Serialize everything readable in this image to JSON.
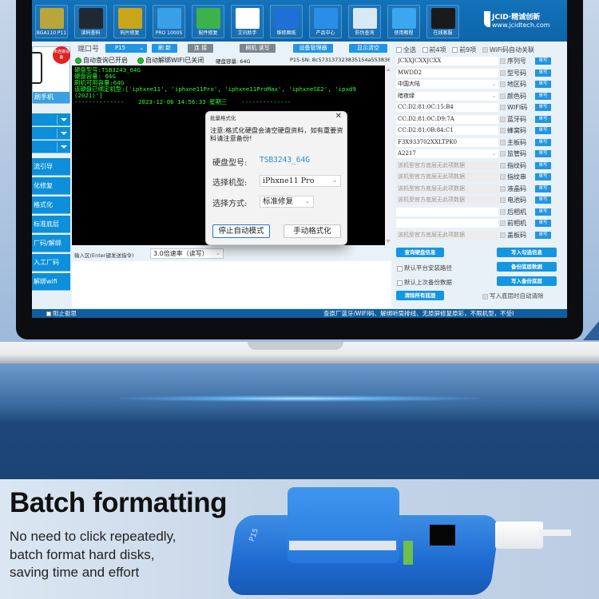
{
  "toolbar": {
    "buttons": [
      {
        "label": "BGA110 P11",
        "icon": "chip-grid-icon",
        "color": "#b8a63a"
      },
      {
        "label": "读码查码",
        "icon": "phone-icon",
        "color": "#222831"
      },
      {
        "label": "码片修复",
        "icon": "chip-dots-icon",
        "color": "#caa51a"
      },
      {
        "label": "PRO 1000S",
        "icon": "device-box-icon",
        "color": "#3b9ee8"
      },
      {
        "label": "配件修复",
        "icon": "battery-phone-icon",
        "color": "#3bb24a"
      },
      {
        "label": "艾讯助手",
        "icon": "aixun-logo-icon",
        "color": "#ffffff"
      },
      {
        "label": "维修图纸",
        "icon": "schematic-icon",
        "color": "#1f6fd6"
      },
      {
        "label": "产品中心",
        "icon": "blocks-icon",
        "color": "#2a8ee8"
      },
      {
        "label": "防伪查询",
        "icon": "barcode-search-icon",
        "color": "#d9e8f5"
      },
      {
        "label": "使用教程",
        "icon": "chat-bubble-icon",
        "color": "#3aa7f0"
      },
      {
        "label": "在线客服",
        "icon": "penguin-icon",
        "color": "#1a1a1a"
      }
    ],
    "brand_name": "JCID·精诚创新",
    "brand_url": "www.jcidtech.com"
  },
  "left": {
    "phone_caption": "刷手机",
    "badge": "未连接设备",
    "items": [
      "流引导",
      "化修复",
      "格式化",
      "标准底层",
      "厂码/解绑",
      "入工厂码",
      "解绑wifi"
    ]
  },
  "controls": {
    "port_label": "端口号",
    "port_value": "P15",
    "refresh": "刷 新",
    "connect": "连 接",
    "flash_rw": "刷机  读写",
    "device_manager": "设备管理器",
    "clear_display": "显示清空"
  },
  "status": {
    "auto_query": "自动查询已开启",
    "auto_unbind": "自动解绑WIFI已关闭",
    "capacity": "硬盘容量: 64G",
    "serial": "P15-SN: 8c573137323835154a553836"
  },
  "console": {
    "lines": [
      "硬盘型号:TSB3243_64G",
      "硬盘容量: 64G",
      "刷机可用容量:64G",
      "该硬盘已绑定机型:['iphxne11', 'iphxne11Pro', 'iphxne11ProMax', 'iphxneSE2', 'ipxd9",
      "(2021)']",
      "--------------    2023-12-06 14:56:33 星期三    --------------"
    ]
  },
  "input": {
    "label": "输入区(Enter键发送指令)",
    "speed": "3.0倍速率（读写）"
  },
  "dialog": {
    "title": "批量格式化",
    "warning": "注意:格式化硬盘会清空硬盘资料，如有重要资料请注意备份!",
    "disk_model_label": "硬盘型号:",
    "disk_model_value": "TSB3243_64G",
    "model_label": "选择机型:",
    "model_value": "iPhxne11 Pro",
    "method_label": "选择方式:",
    "method_value": "标准修复",
    "stop_auto": "停止自动模式",
    "manual_format": "手动格式化"
  },
  "right": {
    "select_all": "全选",
    "first4": "前4项",
    "first9": "前9项",
    "wifi_link": "WiFi码自动关联",
    "single_write": "单写",
    "fields": [
      {
        "value": "JCXXJCXXJCXX",
        "label": "序列号",
        "type": "text"
      },
      {
        "value": "MWDD2",
        "label": "型号码",
        "type": "text"
      },
      {
        "value": "中国大陆",
        "label": "地区码",
        "type": "select"
      },
      {
        "value": "暗夜绿",
        "label": "颜色码",
        "type": "select"
      },
      {
        "value": "CC:D2:81:0C:15:B4",
        "label": "WIFI码",
        "type": "text"
      },
      {
        "value": "CC:D2:81:0C:D9:7A",
        "label": "蓝牙码",
        "type": "text"
      },
      {
        "value": "CC:D2:81:0B:84:C1",
        "label": "蜂窝码",
        "type": "text"
      },
      {
        "value": "F3X933702XXLTPK0",
        "label": "主板码",
        "type": "text"
      },
      {
        "value": "A2217",
        "label": "监管码",
        "type": "select"
      },
      {
        "value": "该机型官方底层无此项数据",
        "label": "指纹码",
        "type": "disabled"
      },
      {
        "value": "该机型官方底层无此项数据",
        "label": "指纹串",
        "type": "disabled"
      },
      {
        "value": "该机型官方底层无此项数据",
        "label": "液晶码",
        "type": "disabled"
      },
      {
        "value": "该机型官方底层无此项数据",
        "label": "电池码",
        "type": "disabled"
      },
      {
        "value": "",
        "label": "后相机",
        "type": "text"
      },
      {
        "value": "",
        "label": "前相机",
        "type": "text"
      },
      {
        "value": "该机型官方底层无此项数据",
        "label": "盖板码",
        "type": "disabled"
      }
    ],
    "query_disk": "查询硬盘信息",
    "write_selected": "写入勾选信息",
    "default_install_path": "默认平台安装路径",
    "backup_base": "备份底层数据",
    "default_last_backup": "默认上次备份数据",
    "write_backup": "写入备份底层",
    "clear_all_base": "清除所有底层",
    "auto_clear": "写入底层时自动清除"
  },
  "statusbar": {
    "left_text": "阻止驱思",
    "right_text": "查原厂蓝牙/WIFI码、解绑听筒排线、无原屏修复原彩，不限机型，不受I"
  },
  "promo": {
    "headline": "Batch formatting",
    "lines": [
      "No need to click repeatedly,",
      "batch format hard disks,",
      "saving time and effort"
    ],
    "device_label": "P15"
  }
}
